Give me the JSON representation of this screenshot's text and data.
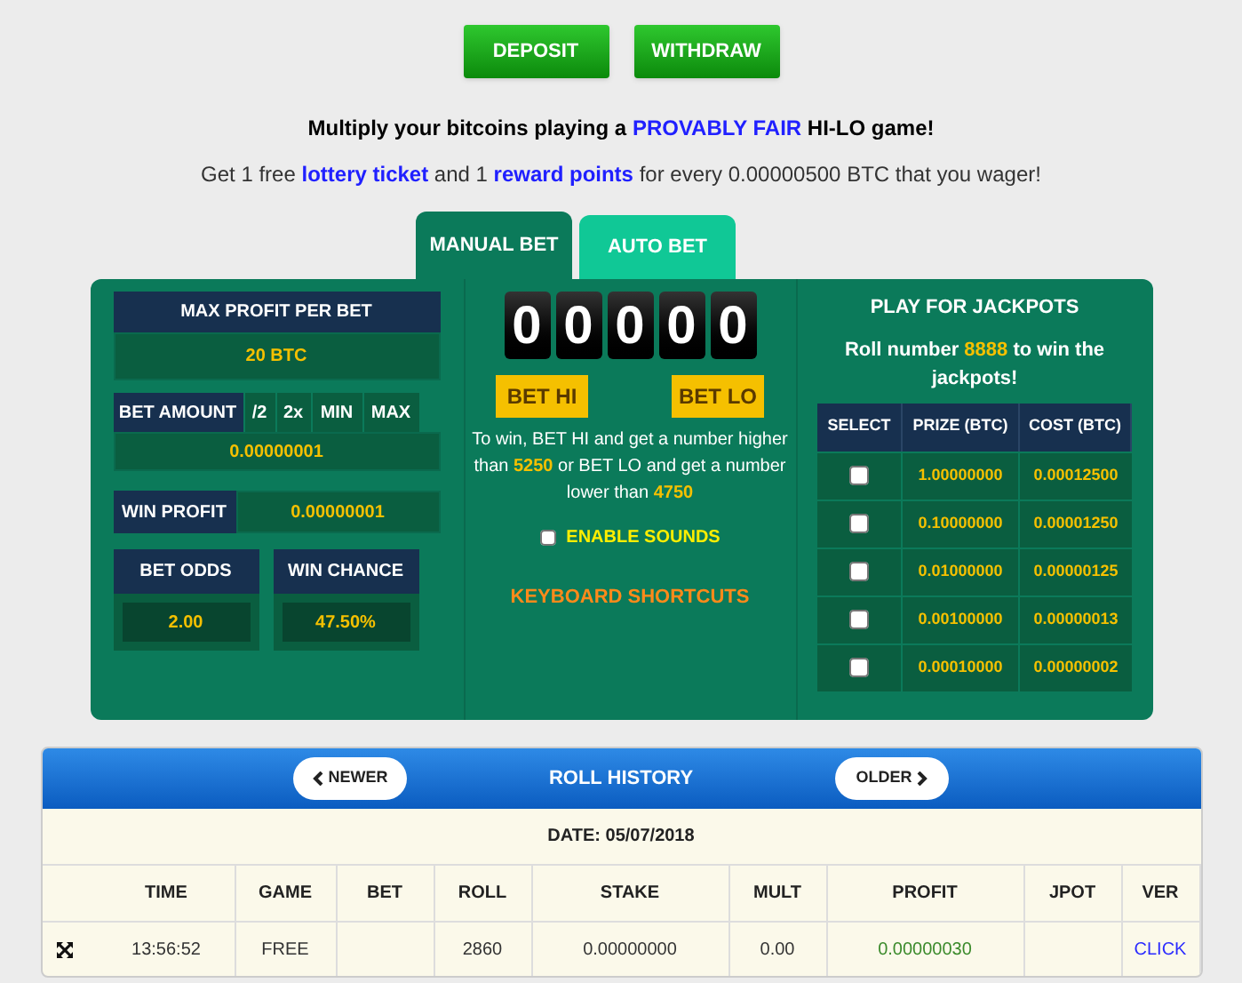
{
  "top_buttons": [
    "DEPOSIT",
    "WITHDRAW"
  ],
  "headline": [
    {
      "text": "Multiply your bitcoins playing a ",
      "highlight": false
    },
    {
      "text": "PROVABLY FAIR",
      "highlight": true
    },
    {
      "text": " HI-LO game!",
      "highlight": false
    }
  ],
  "subline": [
    {
      "text": "Get 1 free ",
      "highlight": false
    },
    {
      "text": "lottery ticket",
      "highlight": true
    },
    {
      "text": " and 1 ",
      "highlight": false
    },
    {
      "text": "reward points",
      "highlight": true
    },
    {
      "text": " for every 0.00000500 BTC that you wager!",
      "highlight": false
    }
  ],
  "tabs": [
    {
      "label": "MANUAL BET",
      "selected": true
    },
    {
      "label": "AUTO BET",
      "selected": false
    }
  ],
  "left": {
    "max_profit_label": "MAX PROFIT PER BET",
    "max_profit_value": "20 BTC",
    "bet_amount_label": "BET AMOUNT",
    "bet_amount_buttons": [
      "/2",
      "2x",
      "MIN",
      "MAX"
    ],
    "bet_amount_value": "0.00000001",
    "win_profit_label": "WIN PROFIT",
    "win_profit_value": "0.00000001",
    "bet_odds_label": "BET ODDS",
    "bet_odds_value": "2.00",
    "win_chance_label": "WIN CHANCE",
    "win_chance_value": "47.50%"
  },
  "digits": [
    "0",
    "0",
    "0",
    "0",
    "0"
  ],
  "bet_buttons": [
    "BET HI",
    "BET LO"
  ],
  "rules": [
    {
      "text": "To win, BET HI and get a number higher than ",
      "highlight": false
    },
    {
      "text": "5250",
      "highlight": true
    },
    {
      "text": " or BET LO and get a number lower than ",
      "highlight": false
    },
    {
      "text": "4750",
      "highlight": true
    }
  ],
  "sounds": {
    "label": "ENABLE SOUNDS",
    "checked": false
  },
  "shortcuts": "KEYBOARD SHORTCUTS",
  "jackpots": {
    "title": "PLAY FOR JACKPOTS",
    "intro": [
      {
        "text": "Roll number ",
        "highlight": false
      },
      {
        "text": "8888",
        "highlight": true
      },
      {
        "text": " to win the jackpots!",
        "highlight": false
      }
    ],
    "columns": [
      "SELECT",
      "PRIZE (BTC)",
      "COST (BTC)"
    ],
    "rows": [
      {
        "checked": false,
        "prize": "1.00000000",
        "cost": "0.00012500"
      },
      {
        "checked": false,
        "prize": "0.10000000",
        "cost": "0.00001250"
      },
      {
        "checked": false,
        "prize": "0.01000000",
        "cost": "0.00000125"
      },
      {
        "checked": false,
        "prize": "0.00100000",
        "cost": "0.00000013"
      },
      {
        "checked": false,
        "prize": "0.00010000",
        "cost": "0.00000002"
      }
    ]
  },
  "history": {
    "newer": "NEWER",
    "title": "ROLL HISTORY",
    "older": "OLDER",
    "date": "DATE: 05/07/2018",
    "columns": [
      "TIME",
      "GAME",
      "BET",
      "ROLL",
      "STAKE",
      "MULT",
      "PROFIT",
      "JPOT",
      "VER"
    ],
    "rows": [
      {
        "time": "13:56:52",
        "game": "FREE",
        "roll": "2860",
        "stake": "0.00000000",
        "mult": "0.00",
        "profit": "0.00000030",
        "ver": "CLICK"
      }
    ]
  }
}
